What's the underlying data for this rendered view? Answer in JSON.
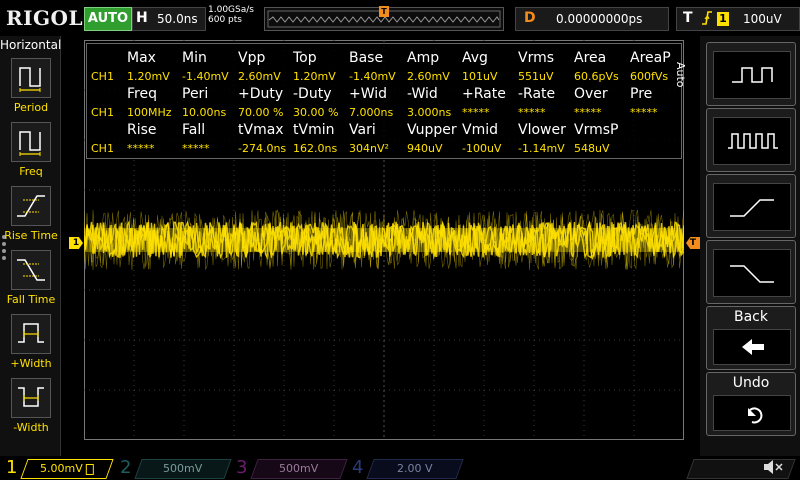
{
  "topbar": {
    "brand": "RIGOL",
    "run_mode": "AUTO",
    "timebase_label": "H",
    "timebase_value": "50.0ns",
    "sample_rate": "1.00GSa/s",
    "memory_depth": "600 pts",
    "trigger_pos_marker": "T",
    "delay_label": "D",
    "delay_value": "0.00000000ps",
    "trigger_label": "T",
    "trigger_edge": "rising-edge-icon",
    "trigger_source": "1",
    "trigger_level": "100uV"
  },
  "left_menu": {
    "title": "Horizontal",
    "items": [
      {
        "label": "Period",
        "icon": "period-icon"
      },
      {
        "label": "Freq",
        "icon": "frequency-icon"
      },
      {
        "label": "Rise Time",
        "icon": "rise-time-icon"
      },
      {
        "label": "Fall Time",
        "icon": "fall-time-icon"
      },
      {
        "label": "+Width",
        "icon": "positive-width-icon"
      },
      {
        "label": "-Width",
        "icon": "negative-width-icon"
      }
    ]
  },
  "measurements": {
    "row1_headers": [
      "Max",
      "Min",
      "Vpp",
      "Top",
      "Base",
      "Amp",
      "Avg",
      "Vrms",
      "Area",
      "AreaP"
    ],
    "row1_values": [
      "1.20mV",
      "-1.40mV",
      "2.60mV",
      "1.20mV",
      "-1.40mV",
      "2.60mV",
      "101uV",
      "551uV",
      "60.6pVs",
      "600fVs"
    ],
    "row2_headers": [
      "Freq",
      "Peri",
      "+Duty",
      "-Duty",
      "+Wid",
      "-Wid",
      "+Rate",
      "-Rate",
      "Over",
      "Pre"
    ],
    "row2_values": [
      "100MHz",
      "10.00ns",
      "70.00 %",
      "30.00 %",
      "7.000ns",
      "3.000ns",
      "*****",
      "*****",
      "*****",
      "*****"
    ],
    "row3_headers": [
      "Rise",
      "Fall",
      "tVmax",
      "tVmin",
      "Vari",
      "Vupper",
      "Vmid",
      "Vlower",
      "VrmsP"
    ],
    "row3_values": [
      "*****",
      "*****",
      "-274.0ns",
      "162.0ns",
      "304nV²",
      "940uV",
      "-100uV",
      "-1.14mV",
      "548uV"
    ],
    "channel_label": "CH1"
  },
  "markers": {
    "ch1_marker": "1",
    "trigger_marker": "T"
  },
  "right_menu": {
    "tab_label": "Auto",
    "buttons": [
      {
        "name": "single-pulse",
        "icon": "single-pulse-icon"
      },
      {
        "name": "pulse-train",
        "icon": "pulse-train-icon"
      },
      {
        "name": "rising-edge",
        "icon": "rising-edge-icon"
      },
      {
        "name": "falling-edge",
        "icon": "falling-edge-icon"
      }
    ],
    "back_label": "Back",
    "undo_label": "Undo"
  },
  "channels": [
    {
      "num": "1",
      "scale": "5.00mV",
      "color": "#ffe100",
      "active": true
    },
    {
      "num": "2",
      "scale": "500mV",
      "color": "#00e0e0",
      "active": false
    },
    {
      "num": "3",
      "scale": "500mV",
      "color": "#e040e0",
      "active": false
    },
    {
      "num": "4",
      "scale": "2.00 V",
      "color": "#3060ff",
      "active": false
    }
  ],
  "colors": {
    "ch1": "#ffe100",
    "trigger": "#f28c1c",
    "auto_green": "#2f9e2f"
  }
}
